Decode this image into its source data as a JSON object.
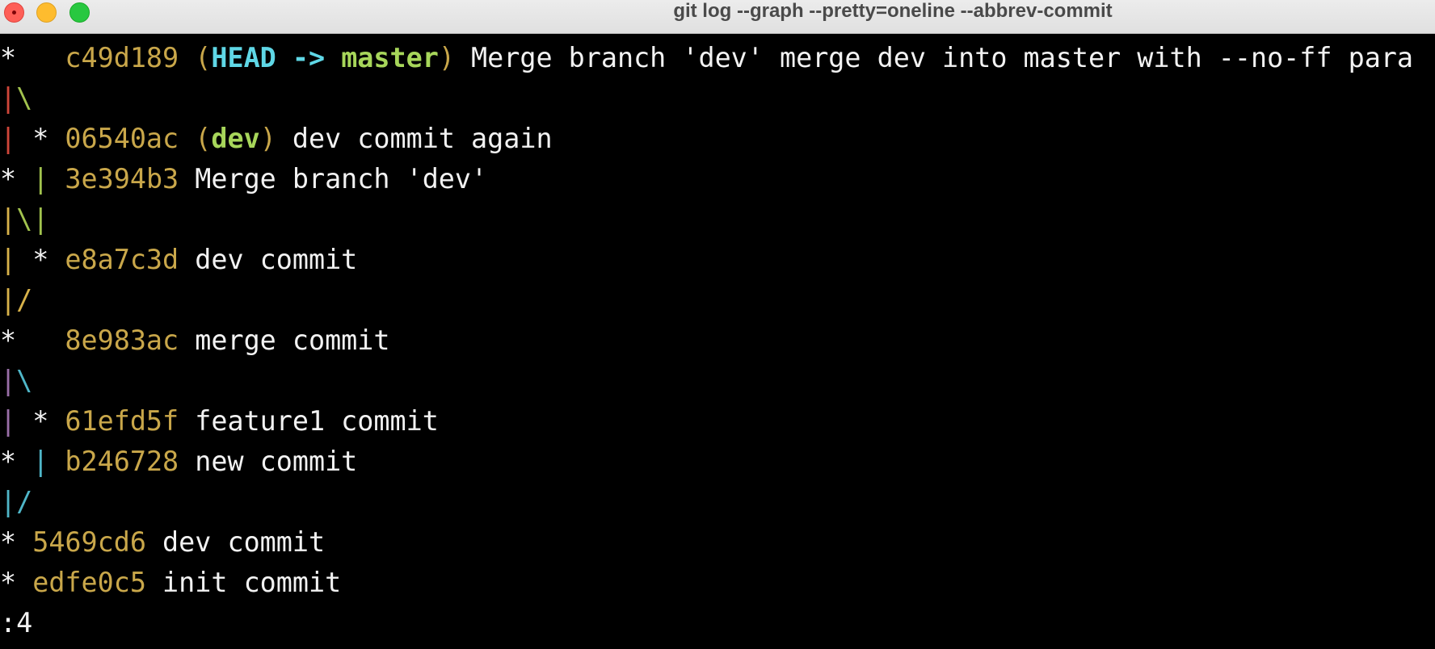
{
  "window": {
    "title": "git log --graph --pretty=oneline --abbrev-commit"
  },
  "colors": {
    "hash": "#c9a74a",
    "head_ref": "#5fd7e6",
    "branch_ref": "#a7d65a",
    "text": "#f2f2f2",
    "background": "#000000",
    "graph_red": "#d0463a",
    "graph_green": "#a2c34e",
    "graph_yellow": "#d8b24a",
    "graph_purple": "#9a6fa8",
    "graph_cyan": "#4fb6c8"
  },
  "log": {
    "l1": {
      "graph": "*   ",
      "hash": "c49d189",
      "open": " (",
      "head": "HEAD -> ",
      "branch": "master",
      "close": ")",
      "message": " Merge branch 'dev' merge dev into master with --no-ff para"
    },
    "l2": {
      "a": "|",
      "b": "\\"
    },
    "l3": {
      "a": "|",
      "star": " * ",
      "hash": "06540ac",
      "open": " (",
      "branch": "dev",
      "close": ")",
      "message": " dev commit again"
    },
    "l4": {
      "star": "* ",
      "b": "|",
      "hash": " 3e394b3",
      "message": " Merge branch 'dev'"
    },
    "l5": {
      "a": "|",
      "b": "\\",
      "c": "|"
    },
    "l6": {
      "a": "|",
      "star": " * ",
      "hash": "e8a7c3d",
      "message": " dev commit"
    },
    "l7": {
      "a": "|",
      "b": "/"
    },
    "l8": {
      "graph": "*   ",
      "hash": "8e983ac",
      "message": " merge commit"
    },
    "l9": {
      "a": "|",
      "b": "\\"
    },
    "l10": {
      "a": "|",
      "star": " * ",
      "hash": "61efd5f",
      "message": " feature1 commit"
    },
    "l11": {
      "star": "* ",
      "b": "|",
      "hash": " b246728",
      "message": " new commit"
    },
    "l12": {
      "a": "|",
      "b": "/"
    },
    "l13": {
      "graph": "* ",
      "hash": "5469cd6",
      "message": " dev commit"
    },
    "l14": {
      "graph": "* ",
      "hash": "edfe0c5",
      "message": " init commit"
    }
  },
  "prompt": {
    "text": ":4"
  }
}
